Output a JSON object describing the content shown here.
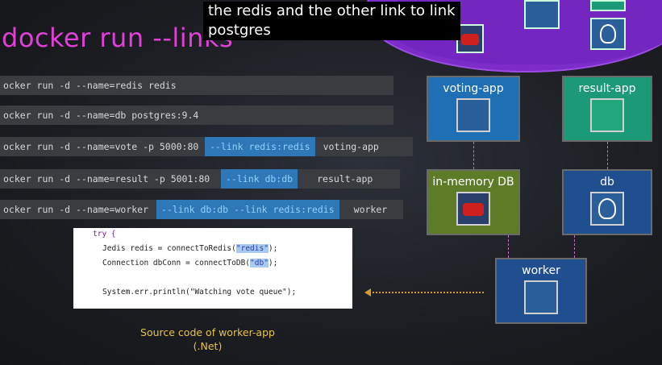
{
  "slide": {
    "title": "docker run --links",
    "subtitle_line1": "the redis and the other link to link",
    "subtitle_line2": "postgres",
    "caption_line1": "Source code of worker-app",
    "caption_line2": "(.Net)"
  },
  "commands": [
    {
      "base": "ocker run -d --name=redis redis",
      "link": "",
      "image": ""
    },
    {
      "base": "ocker run -d --name=db  postgres:9.4",
      "link": "",
      "image": ""
    },
    {
      "base": "ocker run -d --name=vote -p 5000:80",
      "link": "--link redis:redis",
      "image": "voting-app"
    },
    {
      "base": "ocker run -d --name=result -p 5001:80",
      "link": "--link db:db",
      "image": "result-app"
    },
    {
      "base": "ocker run -d --name=worker",
      "link": "--link db:db --link redis:redis",
      "image": "worker"
    }
  ],
  "code": {
    "line1": "try {",
    "line2_pre": "Jedis redis = connectToRedis(",
    "line2_str": "\"redis\"",
    "line2_post": ");",
    "line3_pre": "Connection dbConn = connectToDB(",
    "line3_str": "\"db\"",
    "line3_post": ");",
    "line4": "System.err.println(\"Watching vote queue\");"
  },
  "nodes": {
    "voting_app": "voting-app",
    "result_app": "result-app",
    "in_memory_db": "in-memory DB",
    "db": "db",
    "worker": "worker"
  },
  "colors": {
    "title": "#e040d8",
    "link_bg": "#2f78b8",
    "voting_app_bg": "#1f6fb5",
    "result_app_bg": "#1c9a78",
    "in_memory_db_bg": "#5e7c28",
    "db_bg": "#1f4f8f",
    "worker_bg": "#1f4f8f",
    "cloud": "#7b2cc9",
    "caption": "#e8c24a"
  },
  "icons": [
    "python-icon",
    "nodejs-icon",
    "redis-icon",
    "postgres-icon",
    "worker-icon"
  ]
}
